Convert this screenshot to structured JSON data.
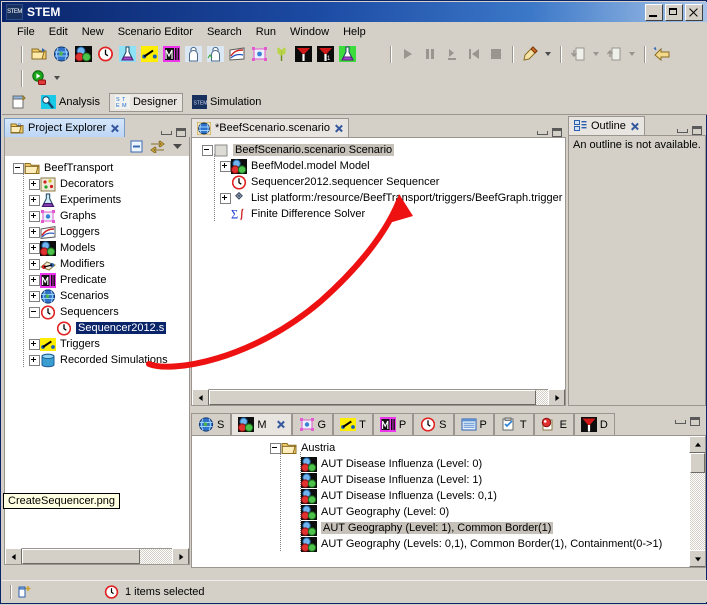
{
  "window": {
    "title": "STEM",
    "logo_text": "STEM",
    "buttons": {
      "minimize": "Minimize",
      "maximize": "Maximize",
      "close": "Close"
    }
  },
  "menu": {
    "items": [
      "File",
      "Edit",
      "New",
      "Scenario Editor",
      "Search",
      "Run",
      "Window",
      "Help"
    ]
  },
  "toolbar": {
    "row1": [
      {
        "name": "open-project-icon",
        "label": "Open Project"
      },
      {
        "name": "new-scenario-icon",
        "label": "New Scenario"
      },
      {
        "name": "new-model-icon",
        "label": "New Model"
      },
      {
        "name": "new-sequencer-icon",
        "label": "New Sequencer"
      },
      {
        "name": "new-experiment-icon",
        "label": "New Experiment"
      },
      {
        "name": "new-trigger-icon",
        "label": "New Trigger"
      },
      {
        "name": "new-predicate-icon",
        "label": "New Predicate"
      },
      {
        "name": "new-population-icon",
        "label": "New Population"
      },
      {
        "name": "new-population-model-icon",
        "label": "New Population Model"
      },
      {
        "name": "new-logger-icon",
        "label": "New Logger"
      },
      {
        "name": "new-graph-icon",
        "label": "New Graph"
      },
      {
        "name": "new-food-production-icon",
        "label": "New Food Production"
      },
      {
        "name": "new-disease-icon",
        "label": "New Disease"
      },
      {
        "name": "new-disease-2-icon",
        "label": "New Disease 2"
      },
      {
        "name": "new-experiment-2-icon",
        "label": "New Experiment 2"
      }
    ],
    "run_group": [
      {
        "name": "run-icon",
        "label": "Run"
      },
      {
        "name": "pause-icon",
        "label": "Pause"
      },
      {
        "name": "step-icon",
        "label": "Step"
      },
      {
        "name": "reset-icon",
        "label": "Reset"
      },
      {
        "name": "stop-icon",
        "label": "Stop"
      }
    ],
    "other_group": [
      {
        "name": "pen-icon",
        "label": "Annotate"
      },
      {
        "name": "import-icon",
        "label": "Import"
      },
      {
        "name": "export-icon",
        "label": "Export"
      },
      {
        "name": "back-icon",
        "label": "Back"
      }
    ],
    "row2": [
      {
        "name": "run-secure-icon",
        "label": "Run Scenario"
      }
    ]
  },
  "perspectives": {
    "new_icon": "new-perspective-icon",
    "items": [
      {
        "label": "Analysis",
        "icon": "analysis-icon",
        "selected": false
      },
      {
        "label": "Designer",
        "icon": "designer-icon",
        "selected": true
      },
      {
        "label": "Simulation",
        "icon": "simulation-icon",
        "selected": false
      }
    ]
  },
  "project_explorer": {
    "tab_label": "Project Explorer",
    "tab_icon": "project-explorer-icon",
    "toolbar_icons": [
      "collapse-all-icon",
      "link-with-editor-icon",
      "view-menu-icon"
    ],
    "tree": [
      {
        "label": "BeefTransport",
        "icon": "folder-icon",
        "indent": 0,
        "expander": "minus"
      },
      {
        "label": "Decorators",
        "icon": "decorators-icon",
        "indent": 1,
        "expander": "plus"
      },
      {
        "label": "Experiments",
        "icon": "experiments-icon",
        "indent": 1,
        "expander": "plus"
      },
      {
        "label": "Graphs",
        "icon": "graphs-icon",
        "indent": 1,
        "expander": "plus"
      },
      {
        "label": "Loggers",
        "icon": "loggers-icon",
        "indent": 1,
        "expander": "plus"
      },
      {
        "label": "Models",
        "icon": "models-icon",
        "indent": 1,
        "expander": "plus"
      },
      {
        "label": "Modifiers",
        "icon": "modifiers-icon",
        "indent": 1,
        "expander": "plus"
      },
      {
        "label": "Predicate",
        "icon": "predicate-icon",
        "indent": 1,
        "expander": "plus"
      },
      {
        "label": "Scenarios",
        "icon": "scenarios-icon",
        "indent": 1,
        "expander": "plus"
      },
      {
        "label": "Sequencers",
        "icon": "sequencers-icon",
        "indent": 1,
        "expander": "minus"
      },
      {
        "label": "Sequencer2012.s",
        "icon": "sequencer-icon",
        "indent": 2,
        "expander": "none",
        "selected": true
      },
      {
        "label": "Triggers",
        "icon": "triggers-icon",
        "indent": 1,
        "expander": "plus"
      },
      {
        "label": "Recorded Simulations",
        "icon": "recorded-simulations-icon",
        "indent": 1,
        "expander": "plus"
      }
    ]
  },
  "editor": {
    "tab_label": "*BeefScenario.scenario",
    "tab_icon": "scenario-icon",
    "tree": [
      {
        "label": "BeefScenario.scenario Scenario",
        "icon": "scenario-icon",
        "indent": 0,
        "expander": "minus",
        "selected": true
      },
      {
        "label": "BeefModel.model Model",
        "icon": "model-icon",
        "indent": 1,
        "expander": "plus"
      },
      {
        "label": "Sequencer2012.sequencer Sequencer",
        "icon": "sequencer-icon",
        "indent": 1,
        "expander": "none"
      },
      {
        "label": "List platform:/resource/BeefTransport/triggers/BeefGraph.trigger",
        "icon": "list-icon",
        "indent": 1,
        "expander": "plus"
      },
      {
        "label": "Finite Difference Solver",
        "icon": "solver-icon",
        "indent": 1,
        "expander": "none"
      }
    ]
  },
  "outline": {
    "tab_label": "Outline",
    "tab_icon": "outline-icon",
    "message": "An outline is not available."
  },
  "bottom_panel": {
    "tabs": [
      {
        "label": "S",
        "icon": "scenarios-tab-icon",
        "active": false
      },
      {
        "label": "M",
        "icon": "models-tab-icon",
        "active": true
      },
      {
        "label": "G",
        "icon": "graphs-tab-icon",
        "active": false
      },
      {
        "label": "T",
        "icon": "triggers-tab-icon",
        "active": false
      },
      {
        "label": "P",
        "icon": "predicate-tab-icon",
        "active": false
      },
      {
        "label": "S",
        "icon": "sequencers-tab-icon",
        "active": false
      },
      {
        "label": "P",
        "icon": "populations-tab-icon",
        "active": false
      },
      {
        "label": "T",
        "icon": "tasks-tab-icon",
        "active": false
      },
      {
        "label": "E",
        "icon": "experiments-tab-icon",
        "active": false
      },
      {
        "label": "D",
        "icon": "diseases-tab-icon",
        "active": false
      }
    ],
    "tree": [
      {
        "label": "Austria",
        "icon": "folder-icon",
        "indent": 0,
        "expander": "minus"
      },
      {
        "label": "AUT Disease Influenza (Level: 0)",
        "icon": "model-icon",
        "indent": 1,
        "expander": "none"
      },
      {
        "label": "AUT Disease Influenza (Level: 1)",
        "icon": "model-icon",
        "indent": 1,
        "expander": "none"
      },
      {
        "label": "AUT Disease Influenza (Levels: 0,1)",
        "icon": "model-icon",
        "indent": 1,
        "expander": "none"
      },
      {
        "label": "AUT Geography (Level: 0)",
        "icon": "model-icon",
        "indent": 1,
        "expander": "none"
      },
      {
        "label": "AUT Geography (Level: 1), Common Border(1)",
        "icon": "model-icon",
        "indent": 1,
        "expander": "none",
        "selected": true
      },
      {
        "label": "AUT Geography (Levels: 0,1), Common Border(1), Containment(0->1)",
        "icon": "model-icon",
        "indent": 1,
        "expander": "none"
      }
    ]
  },
  "tooltip": {
    "text": "CreateSequencer.png"
  },
  "status_bar": {
    "left_icon": "selection-icon",
    "status_icon": "sequencer-icon",
    "text": "1 items selected"
  },
  "annotation": {
    "type": "red-curved-arrow",
    "color": "#ee1111",
    "from": "Sequencer2012.sequencer in Project Explorer",
    "to": "Scenario editor tree"
  },
  "colors": {
    "title_start": "#0a246a",
    "title_end": "#a6c4e8",
    "chrome": "#d4d0c8",
    "selection_blue": "#0a246a",
    "selection_grey": "#c6c2ba",
    "annotation_red": "#ee1111"
  }
}
